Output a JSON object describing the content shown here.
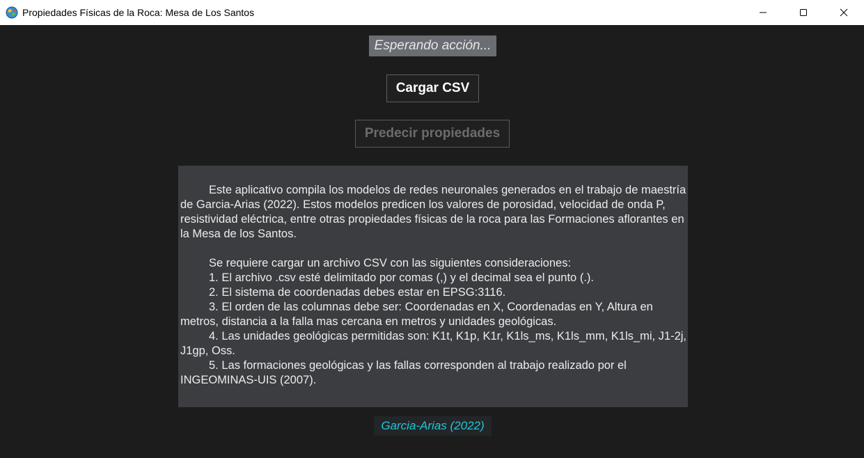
{
  "window": {
    "title": "Propiedades Físicas de la Roca: Mesa de Los Santos",
    "app_icon": "globe-icon",
    "minimize_icon": "minimize-icon",
    "maximize_icon": "maximize-icon",
    "close_icon": "close-icon"
  },
  "status": {
    "text": "Esperando acción..."
  },
  "buttons": {
    "load_csv": "Cargar CSV",
    "predict": "Predecir propiedades"
  },
  "info": {
    "paragraph1": "Este aplicativo compila los modelos de redes neuronales generados en el trabajo de maestría de Garcia-Arias (2022). Estos modelos predicen los valores de porosidad, velocidad de onda P, resistividad eléctrica, entre otras propiedades físicas de la roca para las Formaciones aflorantes en la Mesa de los Santos.",
    "intro": "Se requiere cargar un archivo CSV con las siguientes consideraciones:",
    "items": [
      "1. El archivo .csv esté delimitado por comas (,) y el decimal sea el punto (.).",
      "2. El sistema de coordenadas debes estar en EPSG:3116.",
      "3. El orden de las columnas debe ser: Coordenadas en X, Coordenadas en Y, Altura en metros, distancia a la falla mas cercana en metros y unidades geológicas.",
      "4. Las unidades geológicas permitidas son: K1t, K1p, K1r, K1ls_ms, K1ls_mm, K1ls_mi, J1-2j, J1gp, Oss.",
      "5. Las formaciones geológicas y las fallas corresponden al trabajo realizado por el INGEOMINAS-UIS (2007)."
    ]
  },
  "footer": {
    "credit": "Garcia-Arias (2022)"
  },
  "colors": {
    "background": "#1c1c1c",
    "status_bg": "#6a6e73",
    "info_bg": "#3b3d40",
    "footer_text": "#1ec8d6",
    "disabled_text": "#6c6c6c"
  }
}
